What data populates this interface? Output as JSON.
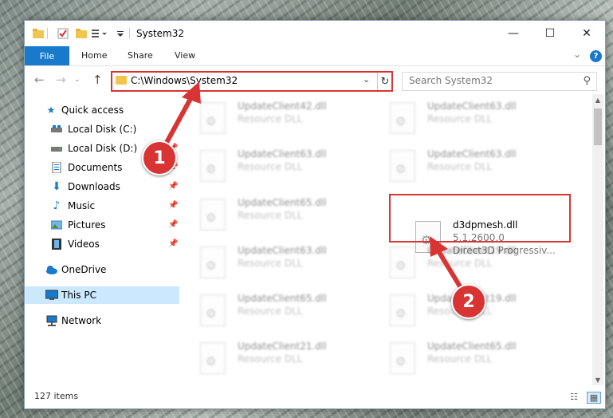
{
  "window": {
    "title": "System32",
    "controls": {
      "minimize": "—",
      "maximize": "☐",
      "close": "✕"
    }
  },
  "ribbon": {
    "tabs": [
      "File",
      "Home",
      "Share",
      "View"
    ],
    "help": "?"
  },
  "address": {
    "path": "C:\\Windows\\System32",
    "search_placeholder": "Search System32"
  },
  "sidebar": {
    "items": [
      {
        "label": "Quick access",
        "icon": "star-icon",
        "pinned": false,
        "selected": false
      },
      {
        "label": "Local Disk (C:)",
        "icon": "drive-icon",
        "pinned": false,
        "selected": false
      },
      {
        "label": "Local Disk (D:)",
        "icon": "drive-icon",
        "pinned": true,
        "selected": false
      },
      {
        "label": "Documents",
        "icon": "documents-icon",
        "pinned": true,
        "selected": false
      },
      {
        "label": "Downloads",
        "icon": "download-icon",
        "pinned": true,
        "selected": false
      },
      {
        "label": "Music",
        "icon": "music-icon",
        "pinned": true,
        "selected": false
      },
      {
        "label": "Pictures",
        "icon": "pictures-icon",
        "pinned": true,
        "selected": false
      },
      {
        "label": "Videos",
        "icon": "videos-icon",
        "pinned": true,
        "selected": false
      },
      {
        "label": "OneDrive",
        "icon": "cloud-icon",
        "pinned": false,
        "selected": false
      },
      {
        "label": "This PC",
        "icon": "computer-icon",
        "pinned": false,
        "selected": true
      },
      {
        "label": "Network",
        "icon": "network-icon",
        "pinned": false,
        "selected": false
      }
    ]
  },
  "files": [
    {
      "name": "UpdateClient42.dll",
      "type": "Resource DLL"
    },
    {
      "name": "UpdateClient63.dll",
      "type": "Resource DLL"
    },
    {
      "name": "UpdateClient63.dll",
      "type": "Resource DLL"
    },
    {
      "name": "UpdateClient63.dll",
      "type": "Resource DLL"
    },
    {
      "name": "UpdateClient65.dll",
      "type": "Resource DLL"
    },
    {
      "name": "d3dpmesh.dll",
      "version": "5.1.2600.0",
      "description": "Direct3D Progressiv..."
    },
    {
      "name": "UpdateClient63.dll",
      "type": "Resource DLL"
    },
    {
      "name": "UpdateClient19.dll",
      "type": "Resource DLL"
    },
    {
      "name": "UpdateClient65.dll",
      "type": "Resource DLL"
    },
    {
      "name": "UpdateClient19.dll",
      "type": "Resource DLL"
    },
    {
      "name": "UpdateClient21.dll",
      "type": "Resource DLL"
    },
    {
      "name": "UpdateClient65.dll",
      "type": "Resource DLL"
    }
  ],
  "status": {
    "item_count": "127 items"
  },
  "callouts": [
    "1",
    "2"
  ],
  "colors": {
    "accent": "#1979ca",
    "highlight": "#d93434",
    "selected": "#cce8ff"
  }
}
